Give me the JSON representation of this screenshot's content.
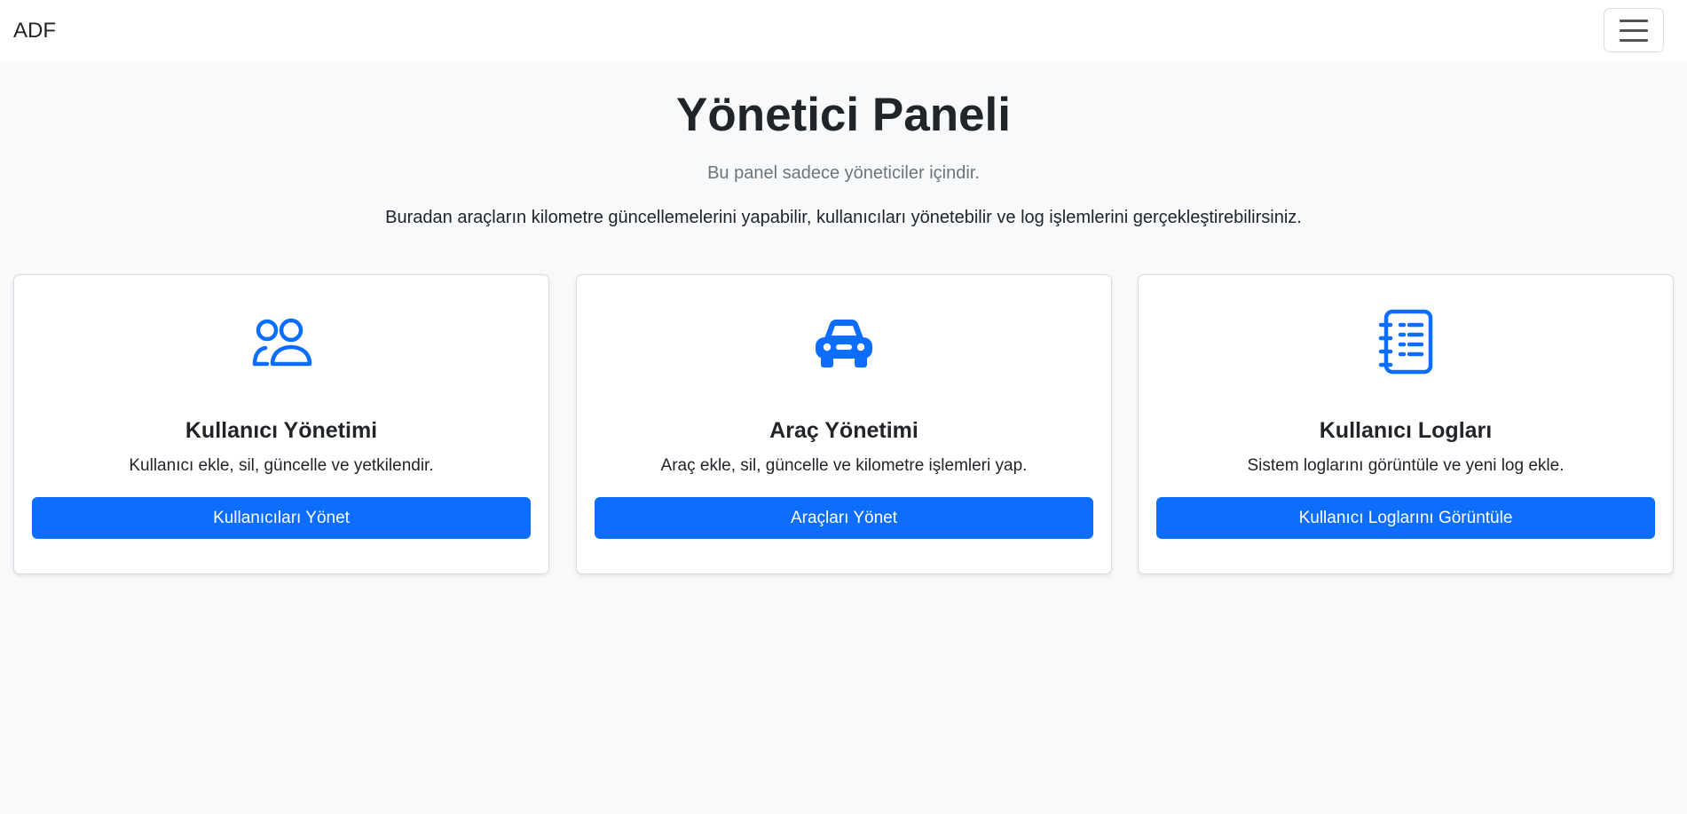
{
  "navbar": {
    "brand": "ADF",
    "toggle_icon": "hamburger-menu-icon"
  },
  "header": {
    "title": "Yönetici Paneli",
    "subtitle": "Bu panel sadece yöneticiler içindir.",
    "description": "Buradan araçların kilometre güncellemelerini yapabilir, kullanıcıları yönetebilir ve log işlemlerini gerçekleştirebilirsiniz."
  },
  "accent_color": "#0d6efd",
  "cards": [
    {
      "icon": "people-icon",
      "title": "Kullanıcı Yönetimi",
      "text": "Kullanıcı ekle, sil, güncelle ve yetkilendir.",
      "button": "Kullanıcıları Yönet"
    },
    {
      "icon": "car-icon",
      "title": "Araç Yönetimi",
      "text": "Araç ekle, sil, güncelle ve kilometre işlemleri yap.",
      "button": "Araçları Yönet"
    },
    {
      "icon": "journal-list-icon",
      "title": "Kullanıcı Logları",
      "text": "Sistem loglarını görüntüle ve yeni log ekle.",
      "button": "Kullanıcı Loglarını Görüntüle"
    }
  ]
}
